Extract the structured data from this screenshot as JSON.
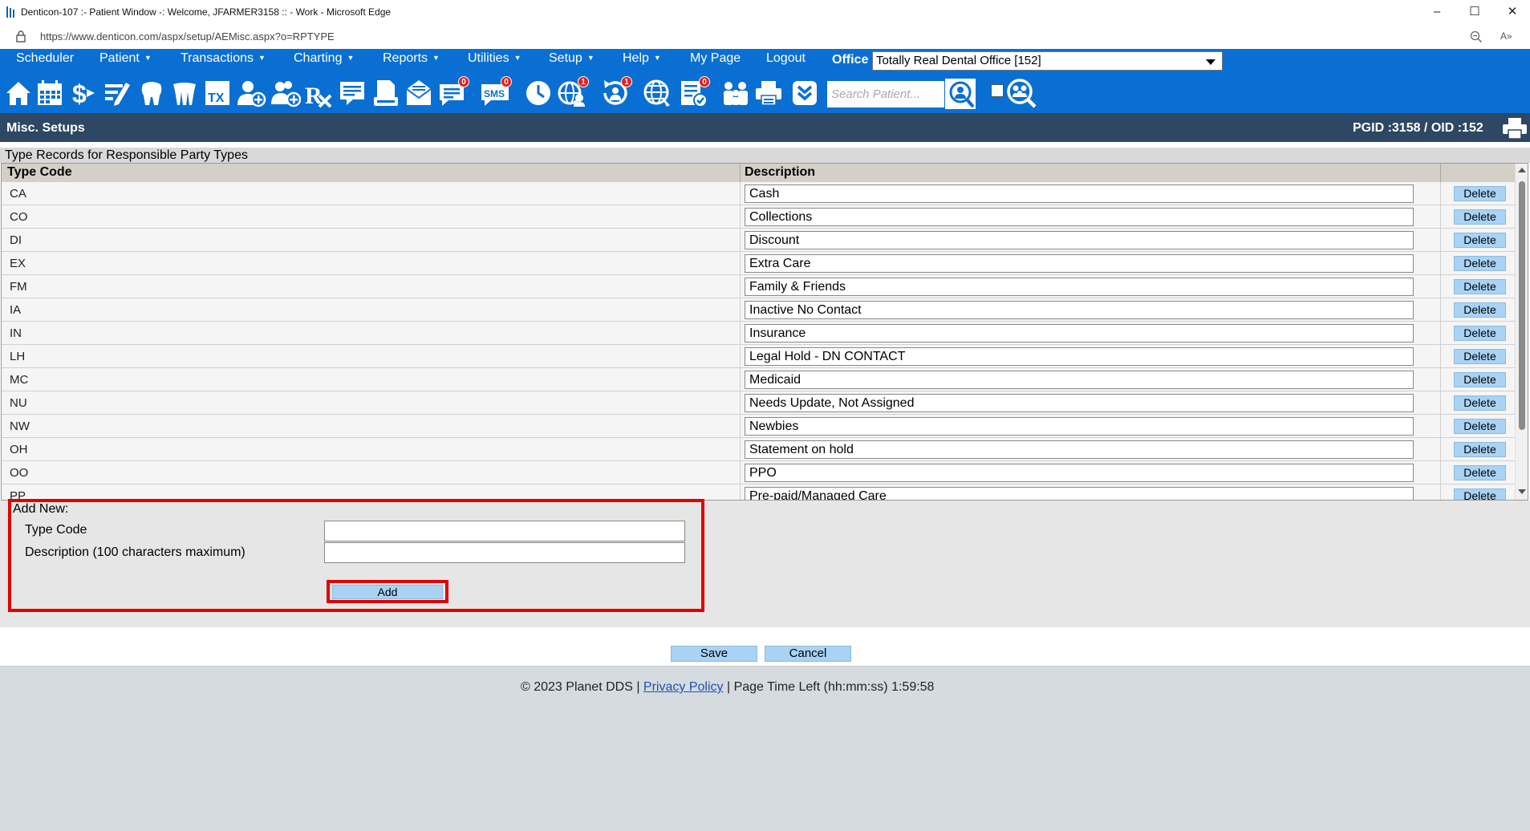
{
  "window": {
    "title": "Denticon-107 :- Patient Window -: Welcome, JFARMER3158 :: - Work - Microsoft Edge",
    "minimize_glyph": "–",
    "maximize_glyph": "☐",
    "close_glyph": "✕"
  },
  "browser": {
    "url": "https://www.denticon.com/aspx/setup/AEMisc.aspx?o=RPTYPE",
    "read_aloud": "A»"
  },
  "menu": {
    "items": [
      {
        "label": "Scheduler",
        "caret": false
      },
      {
        "label": "Patient",
        "caret": true
      },
      {
        "label": "Transactions",
        "caret": true
      },
      {
        "label": "Charting",
        "caret": true
      },
      {
        "label": "Reports",
        "caret": true
      },
      {
        "label": "Utilities",
        "caret": true
      },
      {
        "label": "Setup",
        "caret": true
      },
      {
        "label": "Help",
        "caret": true
      },
      {
        "label": "My Page",
        "caret": false
      },
      {
        "label": "Logout",
        "caret": false
      }
    ],
    "office_label": "Office",
    "office_value": "Totally Real Dental Office [152]"
  },
  "toolbar": {
    "icons": [
      "home-icon",
      "calendar-icon",
      "dollar-icon",
      "pencil-icon",
      "tooth-icon",
      "teeth-icon",
      "tx-icon",
      "add-user-icon",
      "add-group-icon",
      "rx-icon",
      "notes-icon",
      "document-icon",
      "mail-icon",
      "chat-icon",
      "sms-icon",
      "clock-icon",
      "globe-user-icon",
      "refresh-user-icon",
      "web-icon",
      "checklist-icon",
      "family-icon",
      "printer-icon",
      "bookmark-icon"
    ],
    "badges": {
      "chat": "0",
      "sms": "0",
      "globe_user": "1",
      "refresh_user": "1",
      "checklist": "0"
    },
    "sms_text": "SMS",
    "tx_text": "TX",
    "search_placeholder": "Search Patient..."
  },
  "page_header": {
    "title": "Misc. Setups",
    "ids": "PGID :3158  /  OID :152"
  },
  "grid": {
    "section_title": "Type Records for Responsible Party Types",
    "columns": [
      "Type Code",
      "Description"
    ],
    "delete_label": "Delete",
    "rows": [
      {
        "code": "CA",
        "description": "Cash"
      },
      {
        "code": "CO",
        "description": "Collections"
      },
      {
        "code": "DI",
        "description": "Discount"
      },
      {
        "code": "EX",
        "description": "Extra Care"
      },
      {
        "code": "FM",
        "description": "Family & Friends"
      },
      {
        "code": "IA",
        "description": "Inactive No Contact"
      },
      {
        "code": "IN",
        "description": "Insurance"
      },
      {
        "code": "LH",
        "description": "Legal Hold - DN CONTACT"
      },
      {
        "code": "MC",
        "description": "Medicaid"
      },
      {
        "code": "NU",
        "description": "Needs Update, Not Assigned"
      },
      {
        "code": "NW",
        "description": "Newbies"
      },
      {
        "code": "OH",
        "description": "Statement on hold"
      },
      {
        "code": "OO",
        "description": "PPO"
      },
      {
        "code": "PP",
        "description": "Pre-paid/Managed Care"
      }
    ]
  },
  "add_new": {
    "heading": "Add New:",
    "type_code_label": "Type Code",
    "type_code_value": "",
    "description_label": "Description (100 characters maximum)",
    "description_value": "",
    "add_label": "Add"
  },
  "actions": {
    "save_label": "Save",
    "cancel_label": "Cancel"
  },
  "footer": {
    "copyright": "© 2023 Planet DDS |",
    "privacy_link": "Privacy Policy",
    "separator": "|",
    "time_left": "Page Time Left (hh:mm:ss) 1:59:58"
  },
  "colors": {
    "menu_blue": "#0a6fd2",
    "header_navy": "#2d4764",
    "button_blue": "#a9d3f5",
    "highlight_red": "#e00000"
  }
}
